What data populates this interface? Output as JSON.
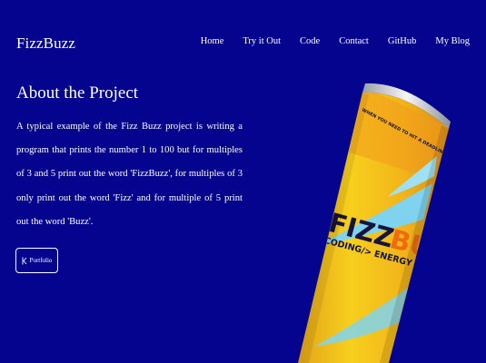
{
  "header": {
    "brand": "FizzBuzz",
    "nav": [
      {
        "label": "Home"
      },
      {
        "label": "Try it Out"
      },
      {
        "label": "Code"
      },
      {
        "label": "Contact"
      },
      {
        "label": "GitHub"
      },
      {
        "label": "My Blog"
      }
    ]
  },
  "main": {
    "title": "About the Project",
    "description": "A typical example of the Fizz Buzz project is writing a program that prints the number 1 to 100 but for multiples of 3 and 5 print out the word 'FizzBuzz', for multiples of 3 only print out the word 'Fizz' and for multiple of 5 print out the word 'Buzz'.",
    "portfolio_button": {
      "label": "Portfolio",
      "icon": "code-icon"
    }
  },
  "can": {
    "brand_fizz": "FIZZ",
    "brand_buzz": "BUZZ",
    "tagline": "CODING/> ENERGY IN A CAN",
    "top_text": "WHEN YOU NEED TO HIT A DEADLINE",
    "colors": {
      "background": "#05048f",
      "can_yellow": "#f4c316",
      "can_orange": "#f39a1c",
      "swoosh_blue": "#7fd3ee",
      "buzz_orange": "#f06a10"
    }
  }
}
